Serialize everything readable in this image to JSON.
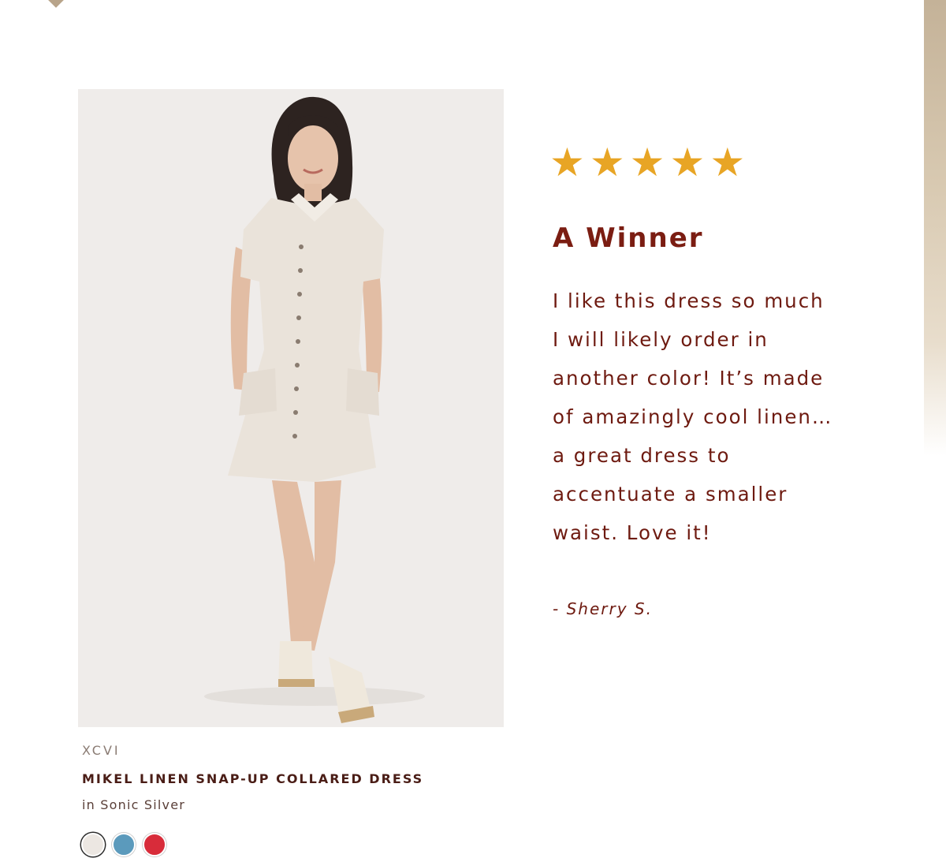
{
  "review": {
    "rating": 5,
    "rating_max": 5,
    "star_icon": "star-icon",
    "star_color": "#e8a525",
    "title": "A Winner",
    "body": "I like this dress so much\nI will likely order in\nanother color! It’s made\nof amazingly cool linen…\na great dress to\naccentuate a smaller\nwaist. Love it!",
    "author": "- Sherry S.",
    "title_color": "#7b1d12"
  },
  "product": {
    "image_icon": "dress-photo",
    "brand": "XCVI",
    "name": "MIKEL LINEN SNAP-UP COLLARED DRESS",
    "color_label": "in Sonic Silver",
    "swatches": [
      {
        "color": "#ece7e2",
        "selected": true
      },
      {
        "color": "#5b9abc",
        "selected": false
      },
      {
        "color": "#d82c3a",
        "selected": false
      }
    ]
  }
}
